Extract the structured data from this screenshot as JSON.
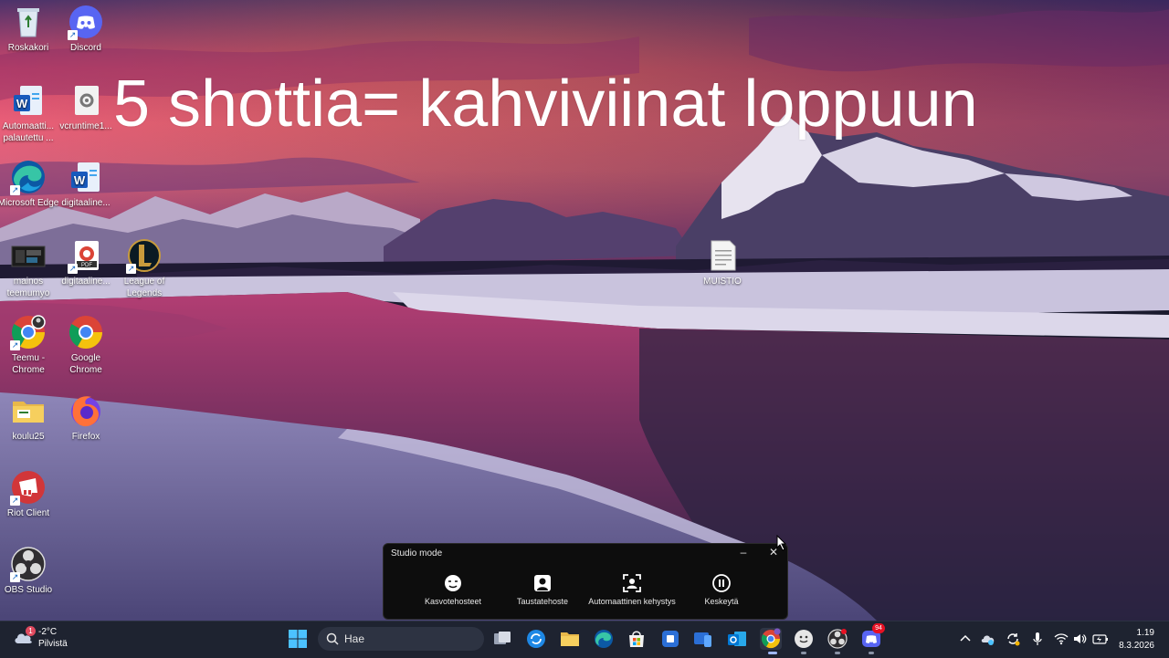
{
  "overlay": {
    "title": "5 shottia= kahviviinat loppuun"
  },
  "desktop": {
    "icons": [
      {
        "label": "Roskakori",
        "icon": "recycle-bin-icon"
      },
      {
        "label": "Discord",
        "icon": "discord-icon"
      },
      {
        "label": "Automaatti... palautettu ...",
        "icon": "word-document-icon"
      },
      {
        "label": "vcruntime1...",
        "icon": "settings-file-icon"
      },
      {
        "label": "Microsoft Edge",
        "icon": "edge-icon"
      },
      {
        "label": "digitaaline...",
        "icon": "word-document-icon"
      },
      {
        "label": "mainos teemumyo",
        "icon": "video-thumbnail-icon"
      },
      {
        "label": "digitaaline...",
        "icon": "pdf-icon"
      },
      {
        "label": "League of Legends",
        "icon": "league-of-legends-icon"
      },
      {
        "label": "MUISTIO",
        "icon": "text-file-icon"
      },
      {
        "label": "Teemu - Chrome",
        "icon": "chrome-profile-icon"
      },
      {
        "label": "Google Chrome",
        "icon": "chrome-icon"
      },
      {
        "label": "koulu25",
        "icon": "folder-icon"
      },
      {
        "label": "Firefox",
        "icon": "firefox-icon"
      },
      {
        "label": "Riot Client",
        "icon": "riot-client-icon"
      },
      {
        "label": "OBS Studio",
        "icon": "obs-icon"
      }
    ]
  },
  "studio_mode": {
    "title": "Studio mode",
    "minimize": "–",
    "close": "✕",
    "options": [
      {
        "label": "Kasvotehosteet",
        "icon": "face-effects-icon"
      },
      {
        "label": "Taustatehoste",
        "icon": "background-effect-icon"
      },
      {
        "label": "Automaattinen kehystys",
        "icon": "auto-framing-icon"
      },
      {
        "label": "Keskeytä",
        "icon": "pause-icon"
      }
    ]
  },
  "taskbar": {
    "weather": {
      "temp": "-2°C",
      "condition": "Pilvistä",
      "badge": "1"
    },
    "search_placeholder": "Hae",
    "discord_badge": "94",
    "clock": {
      "time": "1.19",
      "date": "8.3.2026"
    }
  },
  "colors": {
    "taskbar_bg": "#1e2330",
    "studio_bg": "#0d0d0d",
    "accent_blue": "#0078d4"
  }
}
